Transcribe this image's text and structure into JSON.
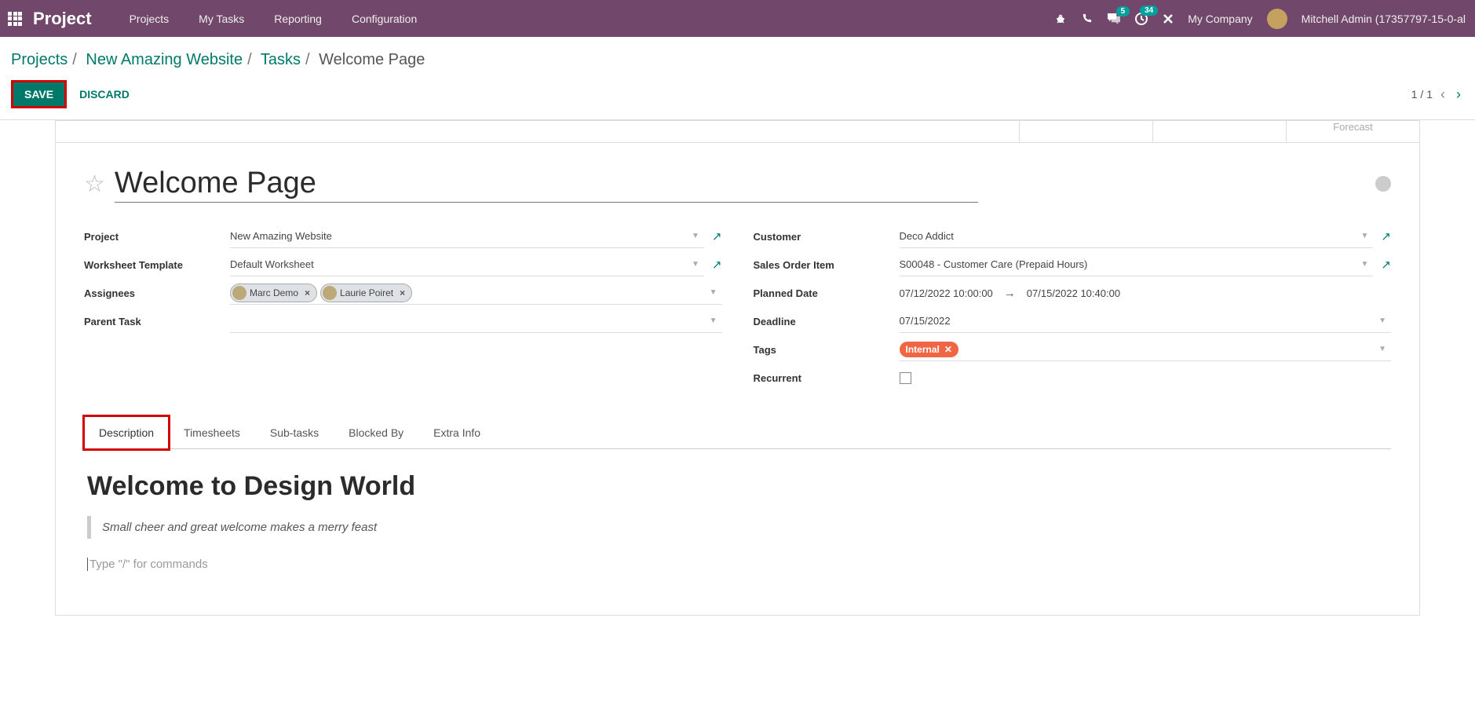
{
  "nav": {
    "brand": "Project",
    "links": [
      "Projects",
      "My Tasks",
      "Reporting",
      "Configuration"
    ],
    "badge_msg": "5",
    "badge_clock": "34",
    "company": "My Company",
    "user": "Mitchell Admin (17357797-15-0-al"
  },
  "breadcrumb": {
    "projects": "Projects",
    "project": "New Amazing Website",
    "tasks": "Tasks",
    "current": "Welcome Page"
  },
  "actions": {
    "save": "SAVE",
    "discard": "DISCARD",
    "pager": "1 / 1"
  },
  "top_strip": {
    "forecast": "Forecast"
  },
  "task": {
    "title": "Welcome Page",
    "labels": {
      "project": "Project",
      "worksheet": "Worksheet Template",
      "assignees": "Assignees",
      "parent": "Parent Task",
      "customer": "Customer",
      "sales_order": "Sales Order Item",
      "planned": "Planned Date",
      "deadline": "Deadline",
      "tags": "Tags",
      "recurrent": "Recurrent"
    },
    "project": "New Amazing Website",
    "worksheet": "Default Worksheet",
    "assignees": [
      {
        "name": "Marc Demo"
      },
      {
        "name": "Laurie Poiret"
      }
    ],
    "customer": "Deco Addict",
    "sales_order": "S00048 - Customer Care (Prepaid Hours)",
    "planned_from": "07/12/2022 10:00:00",
    "planned_to": "07/15/2022 10:40:00",
    "deadline": "07/15/2022",
    "tag": "Internal"
  },
  "tabs": [
    "Description",
    "Timesheets",
    "Sub-tasks",
    "Blocked By",
    "Extra Info"
  ],
  "description": {
    "heading": "Welcome to Design World",
    "quote": "Small cheer and great welcome makes a merry feast",
    "placeholder": "Type \"/\" for commands"
  }
}
